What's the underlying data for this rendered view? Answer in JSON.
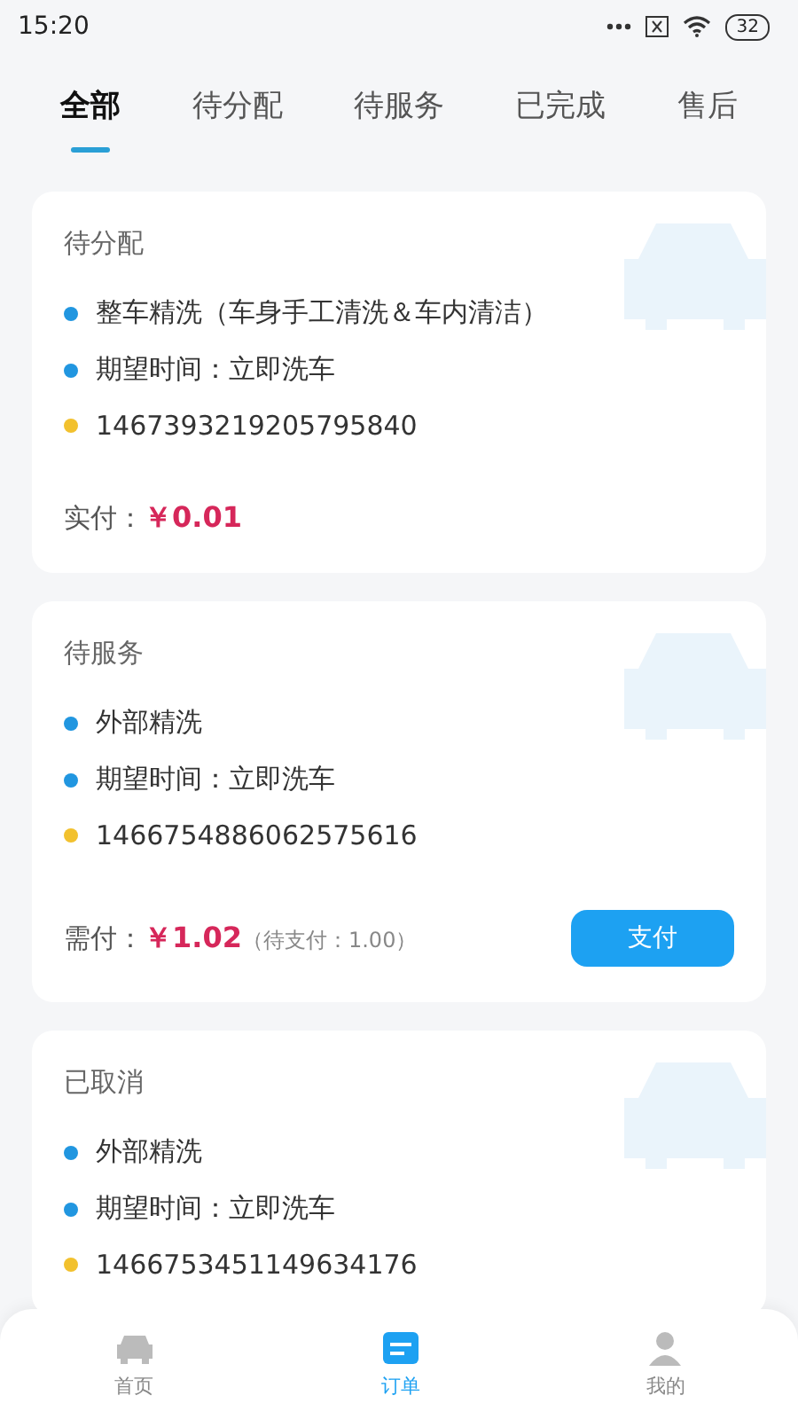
{
  "status_bar": {
    "time": "15:20",
    "battery": "32"
  },
  "tabs": [
    {
      "label": "全部",
      "selected": true
    },
    {
      "label": "待分配",
      "selected": false
    },
    {
      "label": "待服务",
      "selected": false
    },
    {
      "label": "已完成",
      "selected": false
    },
    {
      "label": "售后",
      "selected": false
    }
  ],
  "orders": [
    {
      "status": "待分配",
      "details": [
        {
          "text": "整车精洗（车身手工清洗＆车内清洁）",
          "color": "#2196e0"
        },
        {
          "text": "期望时间：立即洗车",
          "color": "#2196e0"
        },
        {
          "text": "1467393219205795840",
          "color": "#f2c12e"
        }
      ],
      "price_label": "实付：",
      "price": "￥0.01"
    },
    {
      "status": "待服务",
      "details": [
        {
          "text": "外部精洗",
          "color": "#2196e0"
        },
        {
          "text": "期望时间：立即洗车",
          "color": "#2196e0"
        },
        {
          "text": "1466754886062575616",
          "color": "#f2c12e"
        }
      ],
      "price_label": "需付：",
      "price": "￥1.02",
      "price_note": "（待支付：1.00）",
      "action": "支付"
    },
    {
      "status": "已取消",
      "details": [
        {
          "text": "外部精洗",
          "color": "#2196e0"
        },
        {
          "text": "期望时间：立即洗车",
          "color": "#2196e0"
        },
        {
          "text": "1466753451149634176",
          "color": "#f2c12e"
        }
      ]
    }
  ],
  "nav": [
    {
      "label": "首页",
      "kind": "home",
      "selected": false
    },
    {
      "label": "订单",
      "kind": "orders",
      "selected": true
    },
    {
      "label": "我的",
      "kind": "profile",
      "selected": false
    }
  ]
}
